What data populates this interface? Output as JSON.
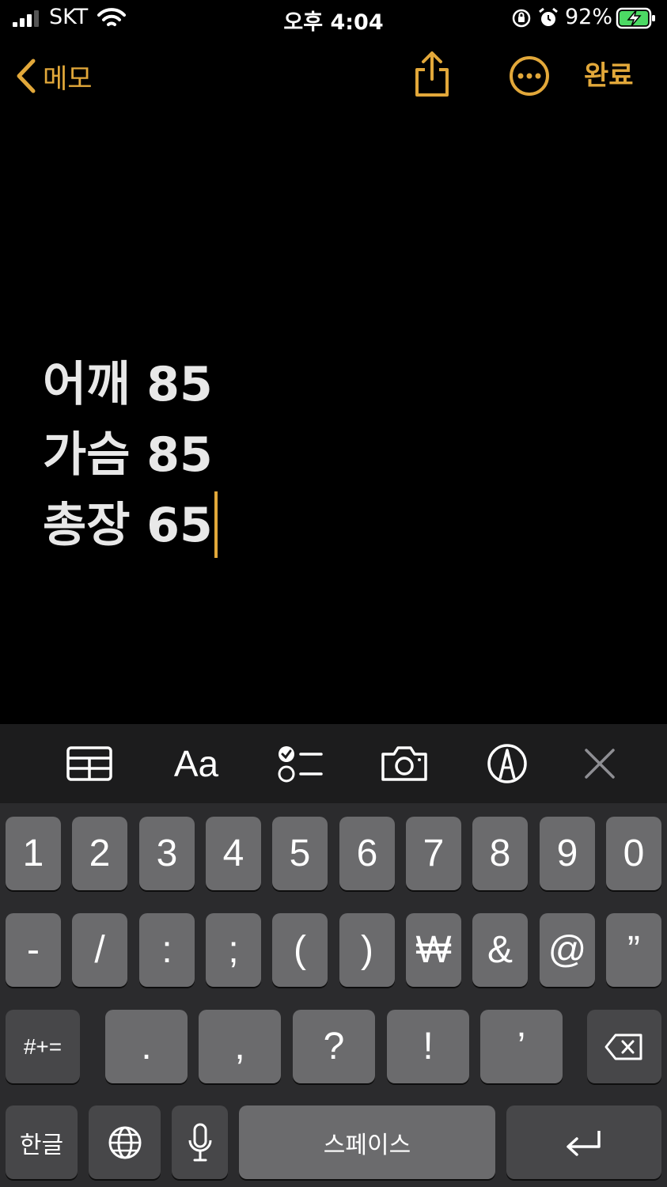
{
  "status_bar": {
    "carrier": "SKT",
    "time": "오후 4:04",
    "battery_percent": "92%",
    "icons": [
      "cellular-signal-icon",
      "wifi-icon",
      "orientation-lock-icon",
      "alarm-icon",
      "battery-charging-icon"
    ]
  },
  "nav": {
    "back_label": "메모",
    "done_label": "완료",
    "icons": [
      "chevron-left-icon",
      "share-icon",
      "more-options-icon"
    ]
  },
  "note": {
    "lines": [
      "어깨 85",
      "가슴 85",
      "총장 65"
    ]
  },
  "toolbar": {
    "format_label": "Aa",
    "icons": [
      "table-icon",
      "format-text-icon",
      "checklist-icon",
      "camera-icon",
      "markup-pen-icon",
      "close-icon"
    ]
  },
  "keyboard": {
    "row1": [
      "1",
      "2",
      "3",
      "4",
      "5",
      "6",
      "7",
      "8",
      "9",
      "0"
    ],
    "row2": [
      "-",
      "/",
      ":",
      ";",
      "(",
      ")",
      "₩",
      "&",
      "@",
      "”"
    ],
    "row3": [
      ".",
      ",",
      "?",
      "!",
      "’"
    ],
    "symbols_label": "#+=",
    "lang_label": "한글",
    "space_label": "스페이스",
    "icons": [
      "delete-icon",
      "globe-icon",
      "microphone-icon",
      "return-icon"
    ]
  },
  "colors": {
    "accent": "#e2a83a",
    "background": "#000000",
    "toolbar_bg": "#1c1c1d",
    "keyboard_bg": "#2b2b2d",
    "key_bg": "#6b6b6d",
    "key_dark_bg": "#474749"
  }
}
